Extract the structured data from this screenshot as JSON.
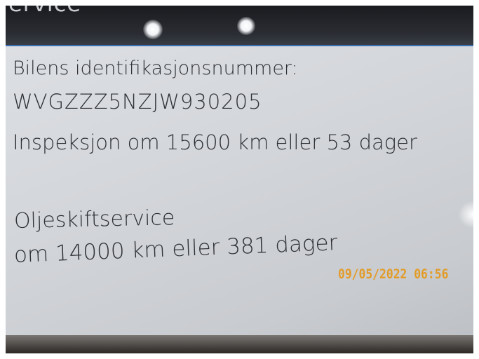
{
  "header": {
    "title": "ervice"
  },
  "screen": {
    "vin_label": "Bilens identifikasjonsnummer:",
    "vin": "WVGZZZ5NZJW930205",
    "inspection": "Inspeksjon om 15600 km eller 53 dager",
    "oil_label": "Oljeskiftservice",
    "oil_due": "om 14000 km eller 381 dager"
  },
  "photo": {
    "timestamp": "09/05/2022 06:56",
    "timestamp_color": "#e39b26"
  },
  "colors": {
    "screen_bg": "#d3d6da",
    "text": "#2e3136",
    "header_bg": "#2a2d33",
    "accent_line": "#3b6fb6"
  }
}
